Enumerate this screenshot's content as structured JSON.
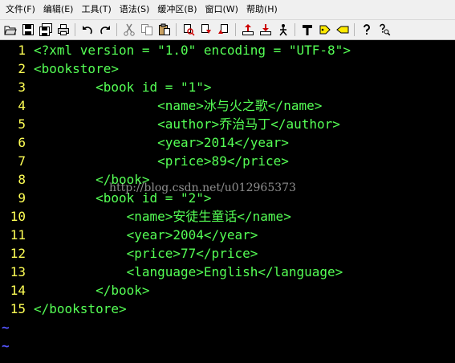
{
  "menu": [
    {
      "id": "file",
      "label": "文件(F)"
    },
    {
      "id": "edit",
      "label": "编辑(E)"
    },
    {
      "id": "tools",
      "label": "工具(T)"
    },
    {
      "id": "syntax",
      "label": "语法(S)"
    },
    {
      "id": "buffers",
      "label": "缓冲区(B)"
    },
    {
      "id": "window",
      "label": "窗口(W)"
    },
    {
      "id": "help",
      "label": "帮助(H)"
    }
  ],
  "toolbar": {
    "icons": [
      "open-icon",
      "save-icon",
      "save-all-icon",
      "print-icon",
      "undo-icon",
      "redo-icon",
      "cut-icon",
      "copy-icon",
      "paste-icon",
      "find-icon",
      "find-next-icon",
      "find-prev-icon",
      "load-session-icon",
      "save-session-icon",
      "run-script-icon",
      "make-icon",
      "build-tags-icon",
      "jump-tag-icon",
      "help-icon",
      "find-help-icon"
    ]
  },
  "editor": {
    "lines": [
      {
        "n": "1",
        "text": "<?xml version = \"1.0\" encoding = \"UTF-8\">"
      },
      {
        "n": "2",
        "text": "<bookstore>"
      },
      {
        "n": "3",
        "text": "        <book id = \"1\">"
      },
      {
        "n": "4",
        "text": "                <name>冰与火之歌</name>"
      },
      {
        "n": "5",
        "text": "                <author>乔治马丁</author>"
      },
      {
        "n": "6",
        "text": "                <year>2014</year>"
      },
      {
        "n": "7",
        "text": "                <price>89</price>"
      },
      {
        "n": "8",
        "text": "        </book>"
      },
      {
        "n": "9",
        "text": "        <book id = \"2\">"
      },
      {
        "n": "10",
        "text": "            <name>安徒生童话</name>"
      },
      {
        "n": "11",
        "text": "            <year>2004</year>"
      },
      {
        "n": "12",
        "text": "            <price>77</price>"
      },
      {
        "n": "13",
        "text": "            <language>English</language>"
      },
      {
        "n": "14",
        "text": "        </book>"
      },
      {
        "n": "15",
        "text": "</bookstore>"
      }
    ],
    "empty_line_marker": "~",
    "colors": {
      "background": "#000000",
      "line_number": "#ffff55",
      "code": "#55ff55",
      "tilde": "#5555ff"
    }
  },
  "watermark": "http://blog.csdn.net/u012965373"
}
